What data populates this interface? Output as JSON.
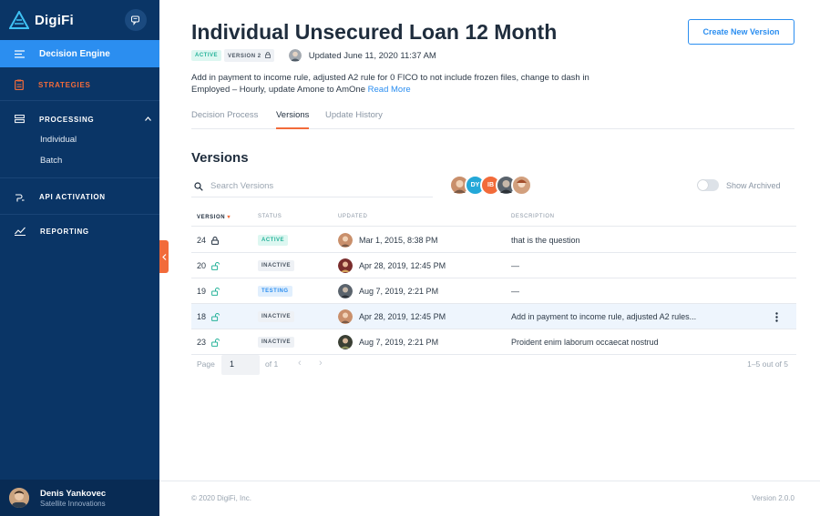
{
  "colors": {
    "sidebar": "#0a3566",
    "accent": "#2b8ef0",
    "orange": "#f26b3a",
    "active_green": "#27b39a"
  },
  "sidebar": {
    "brand": "DigiFi",
    "active_module": "Decision Engine",
    "items": [
      {
        "label": "STRATEGIES",
        "icon": "clipboard-icon"
      },
      {
        "label": "PROCESSING",
        "icon": "layers-icon"
      },
      {
        "label": "API ACTIVATION",
        "icon": "plug-icon"
      },
      {
        "label": "REPORTING",
        "icon": "chart-line-icon"
      }
    ],
    "processing_subitems": [
      "Individual",
      "Batch"
    ],
    "user": {
      "name": "Denis Yankovec",
      "org": "Satellite Innovations"
    }
  },
  "header": {
    "title": "Individual Unsecured Loan 12 Month",
    "create_button": "Create New Version",
    "status_badge": "ACTIVE",
    "version_badge": "VERSION 2",
    "updated": "Updated June 11, 2020 11:37 AM",
    "description": "Add in payment to income rule, adjusted A2 rule for 0 FICO to not include frozen files, change to dash in Employed – Hourly, update Amone to AmOne",
    "read_more": "Read More"
  },
  "tabs": [
    "Decision Process",
    "Versions",
    "Update History"
  ],
  "versions": {
    "title": "Versions",
    "search_placeholder": "Search Versions",
    "avatars": [
      "",
      "DY",
      "IB",
      "",
      ""
    ],
    "show_archived": "Show Archived",
    "columns": [
      "VERSION",
      "STATUS",
      "UPDATED",
      "DESCRIPTION"
    ],
    "rows": [
      {
        "version": "24",
        "lock": "locked",
        "status": "ACTIVE",
        "updated": "Mar 1, 2015, 8:38 PM",
        "description": "that is the question"
      },
      {
        "version": "20",
        "lock": "unlocked",
        "status": "INACTIVE",
        "updated": "Apr 28, 2019, 12:45 PM",
        "description": "—"
      },
      {
        "version": "19",
        "lock": "unlocked",
        "status": "TESTING",
        "updated": "Aug 7, 2019, 2:21 PM",
        "description": "—"
      },
      {
        "version": "18",
        "lock": "unlocked",
        "status": "INACTIVE",
        "updated": "Apr 28, 2019, 12:45 PM",
        "description": "Add in payment to income rule, adjusted A2 rules..."
      },
      {
        "version": "23",
        "lock": "unlocked",
        "status": "INACTIVE",
        "updated": "Aug 7, 2019, 2:21 PM",
        "description": "Proident enim laborum occaecat nostrud"
      }
    ],
    "pager": {
      "label": "Page",
      "page": "1",
      "of": "of 1",
      "prev": "‹",
      "next": "›",
      "range": "1–5 out of 5"
    }
  },
  "footer": {
    "copyright": "© 2020 DigiFi, Inc.",
    "version": "Version 2.0.0"
  }
}
